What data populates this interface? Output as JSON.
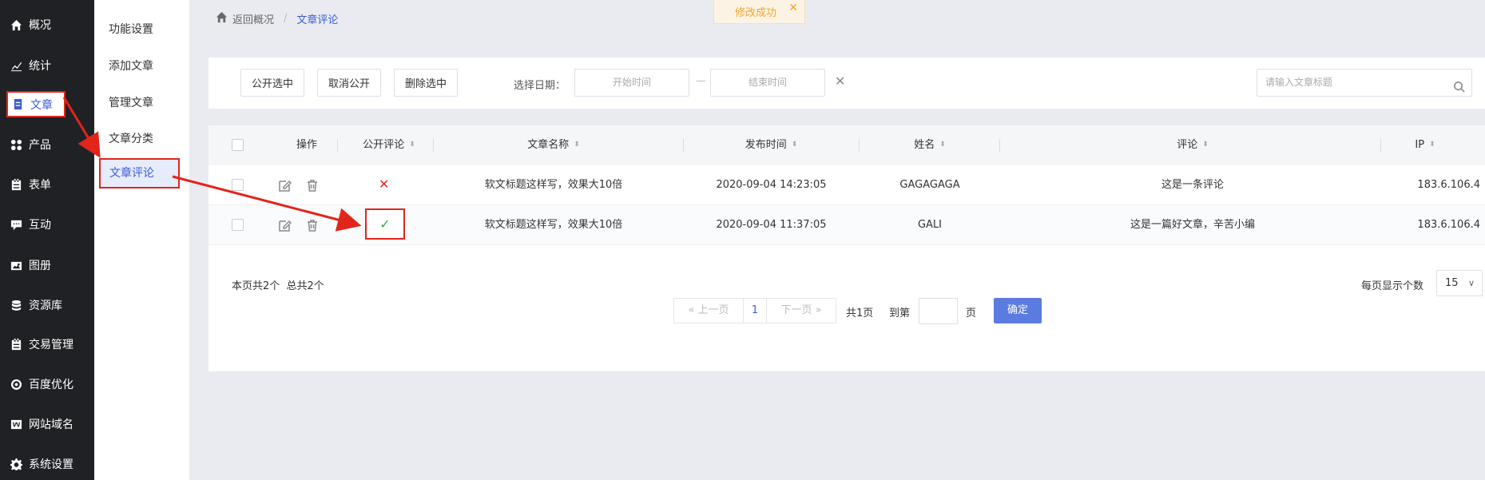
{
  "sidebar": {
    "items": [
      {
        "label": "概况",
        "icon": "home-icon"
      },
      {
        "label": "统计",
        "icon": "chart-icon"
      },
      {
        "label": "文章",
        "icon": "article-icon",
        "active": true
      },
      {
        "label": "产品",
        "icon": "grid-icon"
      },
      {
        "label": "表单",
        "icon": "form-icon"
      },
      {
        "label": "互动",
        "icon": "chat-icon"
      },
      {
        "label": "图册",
        "icon": "album-icon"
      },
      {
        "label": "资源库",
        "icon": "database-icon"
      },
      {
        "label": "交易管理",
        "icon": "trade-icon"
      },
      {
        "label": "百度优化",
        "icon": "seo-icon"
      },
      {
        "label": "网站域名",
        "icon": "domain-icon"
      },
      {
        "label": "系统设置",
        "icon": "gear-icon"
      }
    ]
  },
  "submenu": {
    "items": [
      "功能设置",
      "添加文章",
      "管理文章",
      "文章分类",
      "文章评论"
    ]
  },
  "breadcrumb": {
    "back": "返回概况",
    "separator": "/",
    "current": "文章评论"
  },
  "toast": {
    "message": "修改成功",
    "close": "✕"
  },
  "toolbar": {
    "publish_selected": "公开选中",
    "unpublish": "取消公开",
    "delete_selected": "删除选中",
    "date_label": "选择日期：",
    "start_placeholder": "开始时间",
    "end_placeholder": "结束时间",
    "date_dash": "—",
    "clear": "✕",
    "search_placeholder": "请输入文章标题"
  },
  "table": {
    "headers": [
      "操作",
      "公开评论",
      "文章名称",
      "发布时间",
      "姓名",
      "评论",
      "IP"
    ],
    "rows": [
      {
        "public": false,
        "title": "软文标题这样写，效果大10倍",
        "time": "2020-09-04 14:23:05",
        "name": "GAGAGAGA",
        "comment": "这是一条评论",
        "ip": "183.6.106.4"
      },
      {
        "public": true,
        "title": "软文标题这样写，效果大10倍",
        "time": "2020-09-04 11:37:05",
        "name": "GALI",
        "comment": "这是一篇好文章，辛苦小编",
        "ip": "183.6.106.4"
      }
    ]
  },
  "footer": {
    "summary": "本页共2个  总共2个",
    "per_page_label": "每页显示个数",
    "per_page_value": "15",
    "prev": "上一页",
    "page": "1",
    "next": "下一页",
    "total_pages": "共1页",
    "goto_label": "到第",
    "goto_unit": "页",
    "confirm": "确定"
  },
  "colors": {
    "accent": "#3a5bd9",
    "annotation": "#e1251b",
    "toast": "#f0a830",
    "success": "#3aa845"
  }
}
